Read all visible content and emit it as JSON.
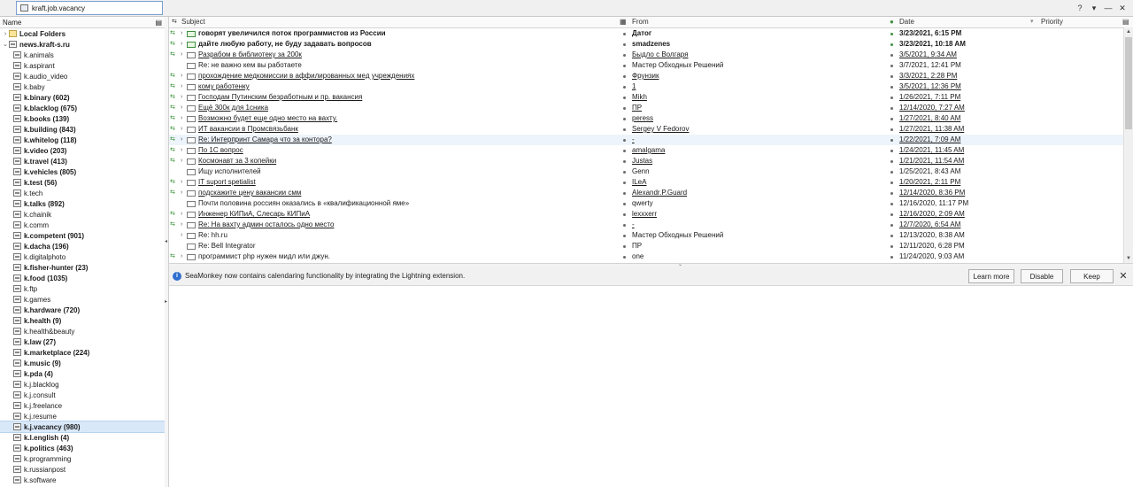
{
  "tab": {
    "title": "kraft.job.vacancy"
  },
  "window_controls": {
    "help": "?",
    "collapse": "▾",
    "minimize": "—",
    "close": "✕"
  },
  "folder_pane": {
    "header_name": "Name",
    "items": [
      {
        "label": "Local Folders",
        "level": 0,
        "twisty": "›",
        "icon": "local",
        "bold": true
      },
      {
        "label": "news.kraft-s.ru",
        "level": 0,
        "twisty": "⌄",
        "icon": "server",
        "bold": true
      },
      {
        "label": "k.animals",
        "level": 1,
        "icon": "news"
      },
      {
        "label": "k.aspirant",
        "level": 1,
        "icon": "news"
      },
      {
        "label": "k.audio_video",
        "level": 1,
        "icon": "news"
      },
      {
        "label": "k.baby",
        "level": 1,
        "icon": "news"
      },
      {
        "label": "k.binary (602)",
        "level": 1,
        "icon": "news",
        "bold": true
      },
      {
        "label": "k.blacklog (675)",
        "level": 1,
        "icon": "news",
        "bold": true
      },
      {
        "label": "k.books (139)",
        "level": 1,
        "icon": "news",
        "bold": true
      },
      {
        "label": "k.building (843)",
        "level": 1,
        "icon": "news",
        "bold": true
      },
      {
        "label": "k.whitelog (118)",
        "level": 1,
        "icon": "news",
        "bold": true
      },
      {
        "label": "k.video (203)",
        "level": 1,
        "icon": "news",
        "bold": true
      },
      {
        "label": "k.travel (413)",
        "level": 1,
        "icon": "news",
        "bold": true
      },
      {
        "label": "k.vehicles (805)",
        "level": 1,
        "icon": "news",
        "bold": true
      },
      {
        "label": "k.test (56)",
        "level": 1,
        "icon": "news",
        "bold": true
      },
      {
        "label": "k.tech",
        "level": 1,
        "icon": "news"
      },
      {
        "label": "k.talks (892)",
        "level": 1,
        "icon": "news",
        "bold": true
      },
      {
        "label": "k.chainik",
        "level": 1,
        "icon": "news"
      },
      {
        "label": "k.comm",
        "level": 1,
        "icon": "news"
      },
      {
        "label": "k.competent (901)",
        "level": 1,
        "icon": "news",
        "bold": true
      },
      {
        "label": "k.dacha (196)",
        "level": 1,
        "icon": "news",
        "bold": true
      },
      {
        "label": "k.digitalphoto",
        "level": 1,
        "icon": "news"
      },
      {
        "label": "k.fisher-hunter (23)",
        "level": 1,
        "icon": "news",
        "bold": true
      },
      {
        "label": "k.food (1035)",
        "level": 1,
        "icon": "news",
        "bold": true
      },
      {
        "label": "k.ftp",
        "level": 1,
        "icon": "news"
      },
      {
        "label": "k.games",
        "level": 1,
        "icon": "news"
      },
      {
        "label": "k.hardware (720)",
        "level": 1,
        "icon": "news",
        "bold": true
      },
      {
        "label": "k.health (9)",
        "level": 1,
        "icon": "news",
        "bold": true
      },
      {
        "label": "k.health&beauty",
        "level": 1,
        "icon": "news"
      },
      {
        "label": "k.law (27)",
        "level": 1,
        "icon": "news",
        "bold": true
      },
      {
        "label": "k.marketplace (224)",
        "level": 1,
        "icon": "news",
        "bold": true
      },
      {
        "label": "k.music (9)",
        "level": 1,
        "icon": "news",
        "bold": true
      },
      {
        "label": "k.pda (4)",
        "level": 1,
        "icon": "news",
        "bold": true
      },
      {
        "label": "k.j.blacklog",
        "level": 1,
        "icon": "news"
      },
      {
        "label": "k.j.consult",
        "level": 1,
        "icon": "news"
      },
      {
        "label": "k.j.freelance",
        "level": 1,
        "icon": "news"
      },
      {
        "label": "k.j.resume",
        "level": 1,
        "icon": "news"
      },
      {
        "label": "k.j.vacancy (980)",
        "level": 1,
        "icon": "news",
        "bold": true,
        "selected": true
      },
      {
        "label": "k.l.english (4)",
        "level": 1,
        "icon": "news",
        "bold": true
      },
      {
        "label": "k.politics (463)",
        "level": 1,
        "icon": "news",
        "bold": true
      },
      {
        "label": "k.programming",
        "level": 1,
        "icon": "news"
      },
      {
        "label": "k.russianpost",
        "level": 1,
        "icon": "news"
      },
      {
        "label": "k.software",
        "level": 1,
        "icon": "news"
      }
    ]
  },
  "thread_pane": {
    "columns": {
      "subject": "Subject",
      "from": "From",
      "date": "Date",
      "priority": "Priority"
    },
    "rows": [
      {
        "subject": "говорят  увеличился поток программистов из России",
        "from": "Датог",
        "date": "3/23/2021, 6:15 PM",
        "bold": true,
        "icon": "unread",
        "read_mark": true,
        "twisty": true,
        "underline": false
      },
      {
        "subject": "дайте любую работу, не буду задавать вопросов",
        "from": "smadzenes",
        "date": "3/23/2021, 10:18 AM",
        "bold": true,
        "icon": "unread",
        "read_mark": true,
        "twisty": true,
        "underline": false
      },
      {
        "subject": "Разрабом в библиотеку за 200к",
        "from": "Быдло с Волгаря",
        "date": "3/5/2021, 9:34 AM",
        "read_mark": true,
        "twisty": true,
        "underline": true
      },
      {
        "subject": "Re: не важно кем вы работаете",
        "from": "Мастер Обходных Решений",
        "date": "3/7/2021, 12:41 PM",
        "read_mark": false,
        "twisty": false,
        "underline": false
      },
      {
        "subject": "прохождение медкомиссии в аффилированных мед учреждениях",
        "from": "Фрунзик",
        "date": "3/3/2021, 2:28 PM",
        "read_mark": true,
        "twisty": true,
        "underline": true
      },
      {
        "subject": "кому работенку",
        "from": "1",
        "date": "3/5/2021, 12:36 PM",
        "read_mark": true,
        "twisty": true,
        "underline": true
      },
      {
        "subject": "Господам Путинским безработным и пр. вакансия",
        "from": "Mikh",
        "date": "1/26/2021, 7:11 PM",
        "read_mark": true,
        "twisty": true,
        "underline": true
      },
      {
        "subject": "Ещё 300к для 1сника",
        "from": "ПР",
        "date": "12/14/2020, 7:27 AM",
        "read_mark": true,
        "twisty": true,
        "underline": true
      },
      {
        "subject": "Возможно будет еще одно место на вахту.",
        "from": "peress",
        "date": "1/27/2021, 8:40 AM",
        "read_mark": true,
        "twisty": true,
        "underline": true
      },
      {
        "subject": "ИТ вакансии в Промсвязьбанк",
        "from": "Sergey V Fedorov",
        "date": "1/27/2021, 11:38 AM",
        "read_mark": true,
        "twisty": true,
        "underline": true
      },
      {
        "subject": "Re: Интерпринт Самара что за контора?",
        "from": "-",
        "date": "1/22/2021, 7:09 AM",
        "read_mark": true,
        "twisty": true,
        "underline": true,
        "highlight": true
      },
      {
        "subject": "По 1С вопрос",
        "from": "amalgama",
        "date": "1/24/2021, 11:45 AM",
        "read_mark": true,
        "twisty": true,
        "underline": true
      },
      {
        "subject": "Космонавт за 3 копейки",
        "from": "Justas",
        "date": "1/21/2021, 11:54 AM",
        "read_mark": true,
        "twisty": true,
        "underline": true
      },
      {
        "subject": "Ищу исполнителей",
        "from": "Genn",
        "date": "1/25/2021, 8:43 AM",
        "read_mark": false,
        "twisty": false,
        "underline": false
      },
      {
        "subject": "IT suport spetialist",
        "from": "ILeA",
        "date": "1/20/2021, 2:11 PM",
        "read_mark": true,
        "twisty": true,
        "underline": true
      },
      {
        "subject": "подскажите цену вакансии смм",
        "from": "Alexandr.P.Guard",
        "date": "12/14/2020, 8:36 PM",
        "read_mark": true,
        "twisty": true,
        "underline": true
      },
      {
        "subject": "Почти половина россиян оказались в «квалификационной яме»",
        "from": "qwerty",
        "date": "12/16/2020, 11:17 PM",
        "read_mark": false,
        "twisty": false,
        "underline": false
      },
      {
        "subject": "Инженер КИПиА, Слесарь КИПиА",
        "from": "lexxxerr",
        "date": "12/16/2020, 2:09 AM",
        "read_mark": true,
        "twisty": true,
        "underline": true
      },
      {
        "subject": "Re: На вахту админ осталось одно место",
        "from": "-",
        "date": "12/7/2020, 6:54 AM",
        "read_mark": true,
        "twisty": true,
        "underline": true
      },
      {
        "subject": "Re: hh.ru",
        "from": "Мастер Обходных Решений",
        "date": "12/13/2020, 8:38 AM",
        "read_mark": false,
        "twisty": true,
        "underline": false
      },
      {
        "subject": "Re: Bell Integrator",
        "from": "ПР",
        "date": "12/11/2020, 6:28 PM",
        "read_mark": false,
        "twisty": false,
        "underline": false
      },
      {
        "subject": "программист php нужен мидл или джун.",
        "from": "one",
        "date": "11/24/2020, 9:03 AM",
        "read_mark": true,
        "twisty": true,
        "underline": false
      }
    ]
  },
  "notification": {
    "text": "SeaMonkey now contains calendaring functionality by integrating the Lightning extension.",
    "learn_more": "Learn more",
    "disable": "Disable",
    "keep": "Keep"
  }
}
